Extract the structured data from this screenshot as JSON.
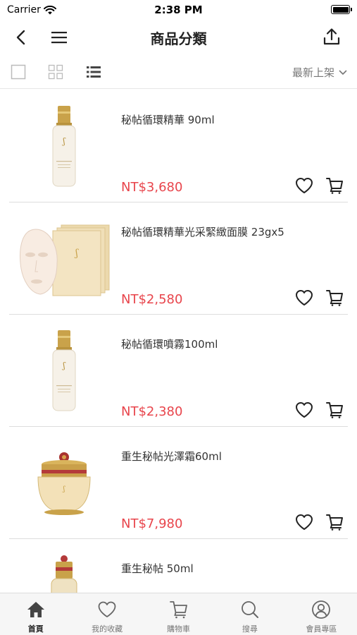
{
  "status_bar": {
    "carrier": "Carrier",
    "time": "2:38 PM"
  },
  "nav": {
    "title": "商品分類"
  },
  "toolbar": {
    "sort_label": "最新上架"
  },
  "products": [
    {
      "name": "秘帖循環精華 90ml",
      "price": "NT$3,680",
      "image": "bottle"
    },
    {
      "name": "秘帖循環精華光采緊緻面膜 23gx5",
      "price": "NT$2,580",
      "image": "mask"
    },
    {
      "name": "秘帖循環噴霧100ml",
      "price": "NT$2,380",
      "image": "bottle"
    },
    {
      "name": "重生秘帖光澤霜60ml",
      "price": "NT$7,980",
      "image": "jar"
    },
    {
      "name": "重生秘帖 50ml",
      "price": "",
      "image": "bottle-red"
    }
  ],
  "tabs": [
    {
      "label": "首頁",
      "icon": "home-icon",
      "active": true
    },
    {
      "label": "我的收藏",
      "icon": "heart-icon",
      "active": false
    },
    {
      "label": "購物車",
      "icon": "cart-icon",
      "active": false
    },
    {
      "label": "搜尋",
      "icon": "search-icon",
      "active": false
    },
    {
      "label": "會員專區",
      "icon": "user-icon",
      "active": false
    }
  ],
  "colors": {
    "price": "#e8454c",
    "gold": "#c9a24a"
  }
}
